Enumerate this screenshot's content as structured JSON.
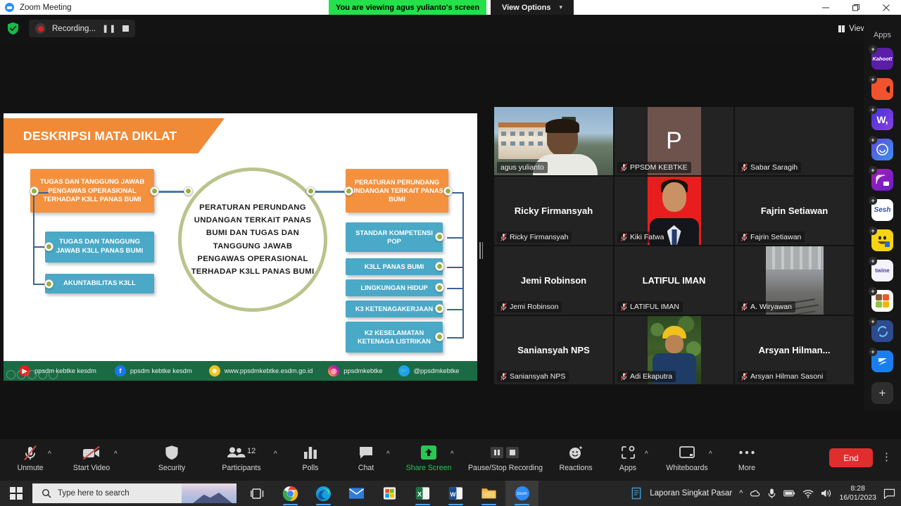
{
  "titlebar": {
    "app_name": "Zoom Meeting",
    "sharing_banner": "You are viewing agus yulianto's screen",
    "view_options_label": "View Options",
    "minimize": "—",
    "restore": "❐",
    "close": "✕"
  },
  "zoom_top": {
    "recording_label": "Recording...",
    "view_label": "View"
  },
  "slide": {
    "title": "DESKRIPSI MATA DIKLAT",
    "center_text": "PERATURAN PERUNDANG UNDANGAN TERKAIT PANAS BUMI DAN TUGAS DAN TANGGUNG JAWAB PENGAWAS OPERASIONAL TERHADAP K3LL PANAS BUMI",
    "left_nodes": [
      {
        "text": "TUGAS DAN TANGGUNG JAWAB PENGAWAS OPERASIONAL TERHADAP K3LL PANAS BUMI",
        "color": "orange"
      },
      {
        "text": "TUGAS DAN TANGGUNG JAWAB K3LL PANAS BUMI",
        "color": "blue"
      },
      {
        "text": "AKUNTABILITAS K3LL",
        "color": "blue"
      }
    ],
    "right_nodes": [
      {
        "text": "PERATURAN PERUNDANG UNDANGAN TERKAIT PANAS BUMI",
        "color": "orange"
      },
      {
        "text": "STANDAR KOMPETENSI POP",
        "color": "blue"
      },
      {
        "text": "K3LL PANAS BUMI",
        "color": "blue"
      },
      {
        "text": "LINGKUNGAN HIDUP",
        "color": "blue"
      },
      {
        "text": "K3 KETENAGAKERJAAN",
        "color": "blue"
      },
      {
        "text": "K2 KESELAMATAN KETENAGA LISTRIKAN",
        "color": "blue"
      }
    ],
    "footer": [
      {
        "icon": "youtube-icon",
        "label": "ppsdm kebtke kesdm",
        "color": "#e02020"
      },
      {
        "icon": "facebook-icon",
        "label": "ppsdm kebtke kesdm",
        "color": "#1877f2"
      },
      {
        "icon": "website-icon",
        "label": "www.ppsdmkebtke.esdm.go.id",
        "color": "#f0c419"
      },
      {
        "icon": "instagram-icon",
        "label": "ppsdmkebtke",
        "color": "#d62976"
      },
      {
        "icon": "twitter-icon",
        "label": "@ppsdmkebtke",
        "color": "#1da1f2"
      }
    ],
    "colors": {
      "header": "#f08a37",
      "orange_node": "#f4913f",
      "blue_node": "#49a9c6",
      "footer": "#1a6b44",
      "circle": "#b9c48c"
    }
  },
  "participants": [
    {
      "display_name": "agus yulianto",
      "big_name": "",
      "kind": "video",
      "muted": false,
      "active": true
    },
    {
      "display_name": "PPSDM KEBTKE",
      "big_name": "",
      "kind": "letter",
      "letter": "P",
      "muted": true,
      "active": false
    },
    {
      "display_name": "Sabar Saragih",
      "big_name": "",
      "kind": "blank",
      "muted": true,
      "active": false
    },
    {
      "display_name": "Ricky Firmansyah",
      "big_name": "Ricky Firmansyah",
      "kind": "name",
      "muted": true,
      "active": false
    },
    {
      "display_name": "Kiki Fatwa",
      "big_name": "",
      "kind": "photo-kiki",
      "muted": true,
      "active": false
    },
    {
      "display_name": "Fajrin Setiawan",
      "big_name": "Fajrin Setiawan",
      "kind": "name",
      "muted": true,
      "active": false
    },
    {
      "display_name": "Jemi Robinson",
      "big_name": "Jemi Robinson",
      "kind": "name",
      "muted": true,
      "active": false
    },
    {
      "display_name": "LATIFUL IMAN",
      "big_name": "LATIFUL IMAN",
      "kind": "name",
      "muted": true,
      "active": false
    },
    {
      "display_name": "A. Wiryawan",
      "big_name": "",
      "kind": "photo-wirya",
      "muted": true,
      "active": false
    },
    {
      "display_name": "Saniansyah NPS",
      "big_name": "Saniansyah NPS",
      "kind": "name",
      "muted": true,
      "active": false
    },
    {
      "display_name": "Adi Ekaputra",
      "big_name": "",
      "kind": "photo-adi",
      "muted": true,
      "active": false
    },
    {
      "display_name": "Arsyan Hilman Sasoni",
      "big_name": "Arsyan  Hilman...",
      "kind": "name",
      "muted": true,
      "active": false
    }
  ],
  "toolbar": {
    "unmute_label": "Unmute",
    "start_video_label": "Start Video",
    "security_label": "Security",
    "participants_label": "Participants",
    "participants_count": "12",
    "polls_label": "Polls",
    "chat_label": "Chat",
    "share_screen_label": "Share Screen",
    "pause_stop_recording_label": "Pause/Stop Recording",
    "reactions_label": "Reactions",
    "apps_label": "Apps",
    "whiteboards_label": "Whiteboards",
    "more_label": "More",
    "end_label": "End",
    "share_color": "#2bc653",
    "end_color": "#e02d2d"
  },
  "apps_panel": {
    "title": "Apps",
    "items": [
      {
        "name": "kahoot",
        "label": "Kahoot!",
        "color": "#5b1ea8",
        "text_color": "#ffffff"
      },
      {
        "name": "puzzle-app",
        "label": "",
        "color": "#f2522e",
        "text_color": "#ffffff"
      },
      {
        "name": "wordly",
        "label": "W,",
        "color": "#4134d4",
        "text_color": "#ffffff"
      },
      {
        "name": "smiley-video",
        "label": "",
        "color": "#5a4de0",
        "text_color": "#ffffff"
      },
      {
        "name": "warpwire",
        "label": "",
        "color": "#a41fb5",
        "text_color": "#ffffff"
      },
      {
        "name": "sesh",
        "label": "Sesh",
        "color": "#ffffff",
        "text_color": "#2d4fa8"
      },
      {
        "name": "funny-face",
        "label": "",
        "color": "#f5d416",
        "text_color": "#333333"
      },
      {
        "name": "twine",
        "label": "twine",
        "color": "#f4f2fb",
        "text_color": "#4c3fa0"
      },
      {
        "name": "color-grid",
        "label": "",
        "color": "#ffffff",
        "text_color": "#333333"
      },
      {
        "name": "sync-app",
        "label": "",
        "color": "#2d4b8e",
        "text_color": "#ffffff"
      },
      {
        "name": "e-app",
        "label": "",
        "color": "#1a7ef0",
        "text_color": "#ffffff"
      }
    ],
    "add_label": "+"
  },
  "taskbar": {
    "search_placeholder": "Type here to search",
    "apps": [
      {
        "name": "task-view-icon"
      },
      {
        "name": "chrome-icon"
      },
      {
        "name": "edge-icon"
      },
      {
        "name": "mail-icon"
      },
      {
        "name": "store-icon"
      },
      {
        "name": "excel-icon"
      },
      {
        "name": "word-icon"
      },
      {
        "name": "file-explorer-icon"
      },
      {
        "name": "zoom-icon"
      }
    ],
    "tray_item_label": "Laporan Singkat Pasar",
    "time": "8:28",
    "date": "16/01/2023"
  }
}
